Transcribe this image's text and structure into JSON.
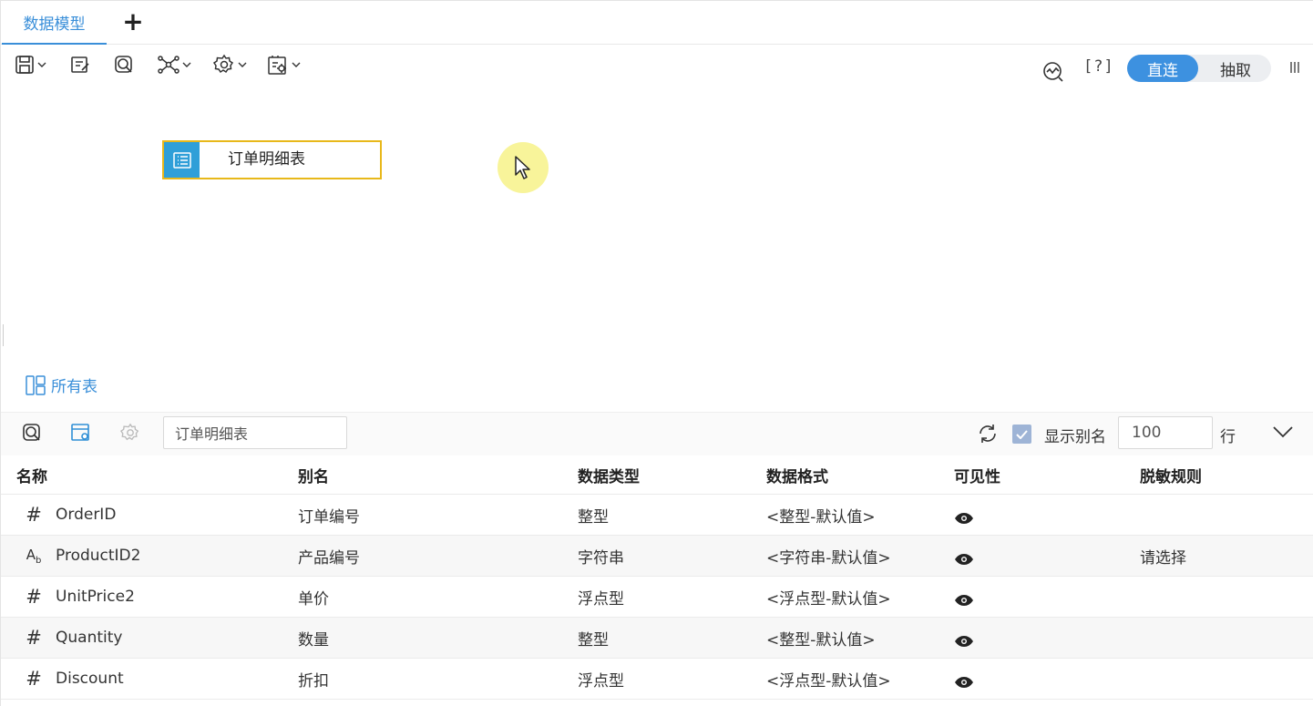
{
  "tabs": {
    "active": "数据模型",
    "add": "+"
  },
  "toolbar": {
    "icons": [
      "save-icon",
      "edit-icon",
      "search-preview-icon",
      "relation-icon",
      "settings-icon",
      "data-settings-icon"
    ],
    "right_icons": [
      "performance-icon",
      "help-icon",
      "columns-icon"
    ],
    "help_text": "[?]",
    "mode": {
      "direct": "直连",
      "extract": "抽取",
      "selected": "直连"
    }
  },
  "canvas": {
    "node_label": "订单明细表",
    "all_tables_label": "所有表"
  },
  "bottom_toolbar": {
    "table_name_value": "订单明细表",
    "show_alias_label": "显示别名",
    "show_alias_checked": true,
    "row_count_value": "100",
    "row_unit": "行"
  },
  "grid": {
    "headers": {
      "name": "名称",
      "alias": "别名",
      "data_type": "数据类型",
      "data_format": "数据格式",
      "visibility": "可见性",
      "masking": "脱敏规则"
    },
    "rows": [
      {
        "type_icon": "#",
        "name": "OrderID",
        "alias": "订单编号",
        "data_type": "整型",
        "data_format": "<整型-默认值>",
        "visible": true,
        "masking": ""
      },
      {
        "type_icon": "Ab",
        "name": "ProductID2",
        "alias": "产品编号",
        "data_type": "字符串",
        "data_format": "<字符串-默认值>",
        "visible": true,
        "masking": "请选择"
      },
      {
        "type_icon": "#",
        "name": "UnitPrice2",
        "alias": "单价",
        "data_type": "浮点型",
        "data_format": "<浮点型-默认值>",
        "visible": true,
        "masking": ""
      },
      {
        "type_icon": "#",
        "name": "Quantity",
        "alias": "数量",
        "data_type": "整型",
        "data_format": "<整型-默认值>",
        "visible": true,
        "masking": ""
      },
      {
        "type_icon": "#",
        "name": "Discount",
        "alias": "折扣",
        "data_type": "浮点型",
        "data_format": "<浮点型-默认值>",
        "visible": true,
        "masking": ""
      }
    ]
  },
  "colors": {
    "accent": "#3d91e0",
    "node_border": "#e8b81a",
    "node_icon_bg": "#2f9fd8"
  }
}
